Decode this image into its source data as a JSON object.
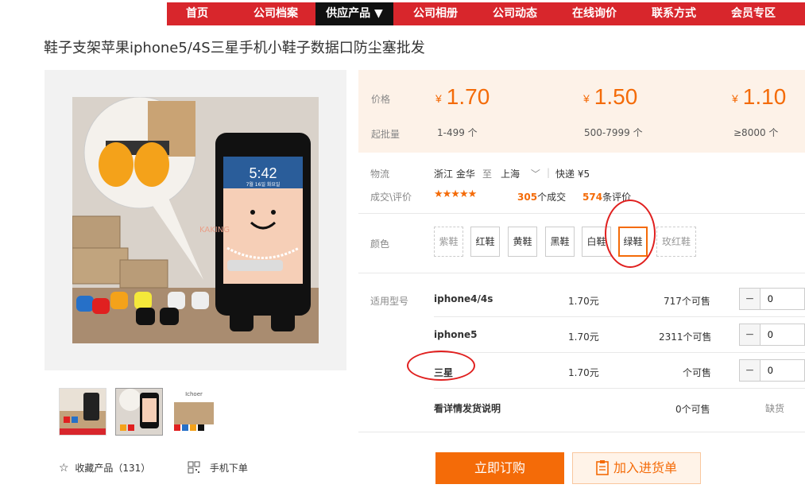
{
  "nav": {
    "items": [
      "首页",
      "公司档案",
      "供应产品 ▼",
      "公司相册",
      "公司动态",
      "在线询价",
      "联系方式",
      "会员专区"
    ]
  },
  "product": {
    "title": "鞋子支架苹果iphone5/4S三星手机小鞋子数据口防尘塞批发",
    "photo_time": "5:42",
    "photo_date": "7월 16일 화요일",
    "watermark": "KAKING",
    "thumb3_caption": "Ichoer"
  },
  "price_panel": {
    "price_label": "价格",
    "moq_label": "起批量",
    "currency": "¥",
    "tiers": [
      {
        "price": "1.70",
        "range": "1-499 个"
      },
      {
        "price": "1.50",
        "range": "500-7999 个"
      },
      {
        "price": "1.10",
        "range": "≥8000 个"
      }
    ]
  },
  "logistics": {
    "label": "物流",
    "from": "浙江 金华",
    "to_word": "至",
    "to": "上海",
    "express": "快递 ¥5"
  },
  "deals": {
    "label": "成交\\评价",
    "deal_count": "305",
    "deal_suffix": "个成交",
    "review_count": "574",
    "review_suffix": "条评价",
    "stars": "★★★★★"
  },
  "colors": {
    "label": "颜色",
    "options": [
      "紫鞋",
      "红鞋",
      "黄鞋",
      "黑鞋",
      "白鞋",
      "绿鞋",
      "玫红鞋"
    ],
    "selected": "绿鞋"
  },
  "models": {
    "label": "适用型号",
    "rows": [
      {
        "name": "iphone4/4s",
        "price": "1.70元",
        "stock": "717个可售",
        "qty": "0"
      },
      {
        "name": "iphone5",
        "price": "1.70元",
        "stock": "2311个可售",
        "qty": "0"
      },
      {
        "name": "三星",
        "price": "1.70元",
        "stock": "个可售",
        "qty": "0"
      },
      {
        "name": "看详情发货说明",
        "price": "",
        "stock": "0个可售",
        "status": "缺货"
      }
    ]
  },
  "actions": {
    "favorite": "收藏产品（131）",
    "mobile_order": "手机下单",
    "buy_now": "立即订购",
    "add_cart": "加入进货单"
  },
  "colors_theme": {
    "nav_red": "#d8262c",
    "accent_orange": "#f46b08",
    "annotation_red": "#e0201f"
  }
}
